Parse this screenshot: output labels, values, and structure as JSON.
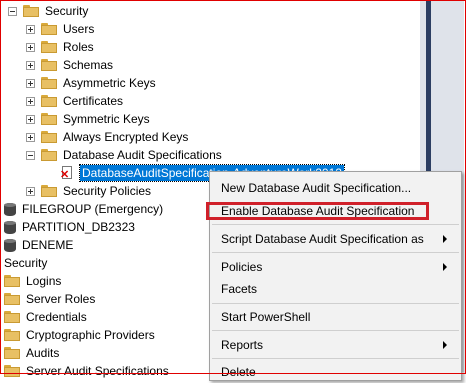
{
  "tree": {
    "items": [
      {
        "label": "Security"
      },
      {
        "label": "Users"
      },
      {
        "label": "Roles"
      },
      {
        "label": "Schemas"
      },
      {
        "label": "Asymmetric Keys"
      },
      {
        "label": "Certificates"
      },
      {
        "label": "Symmetric Keys"
      },
      {
        "label": "Always Encrypted Keys"
      },
      {
        "label": "Database Audit Specifications"
      },
      {
        "label": "DatabaseAuditSpecification-AdventureWork2012"
      },
      {
        "label": "Security Policies"
      },
      {
        "label": "FILEGROUP (Emergency)"
      },
      {
        "label": "PARTITION_DB2323"
      },
      {
        "label": "DENEME"
      },
      {
        "label": "Security"
      },
      {
        "label": "Logins"
      },
      {
        "label": "Server Roles"
      },
      {
        "label": "Credentials"
      },
      {
        "label": "Cryptographic Providers"
      },
      {
        "label": "Audits"
      },
      {
        "label": "Server Audit Specifications"
      }
    ]
  },
  "context_menu": {
    "items": [
      {
        "label": "New Database Audit Specification..."
      },
      {
        "label": "Enable Database Audit Specification"
      },
      {
        "label": "Script Database Audit Specification as"
      },
      {
        "label": "Policies"
      },
      {
        "label": "Facets"
      },
      {
        "label": "Start PowerShell"
      },
      {
        "label": "Reports"
      },
      {
        "label": "Delete"
      }
    ]
  },
  "colors": {
    "selection": "#0078d7",
    "highlight_box": "#d0202a",
    "frame_border": "#e00000"
  }
}
